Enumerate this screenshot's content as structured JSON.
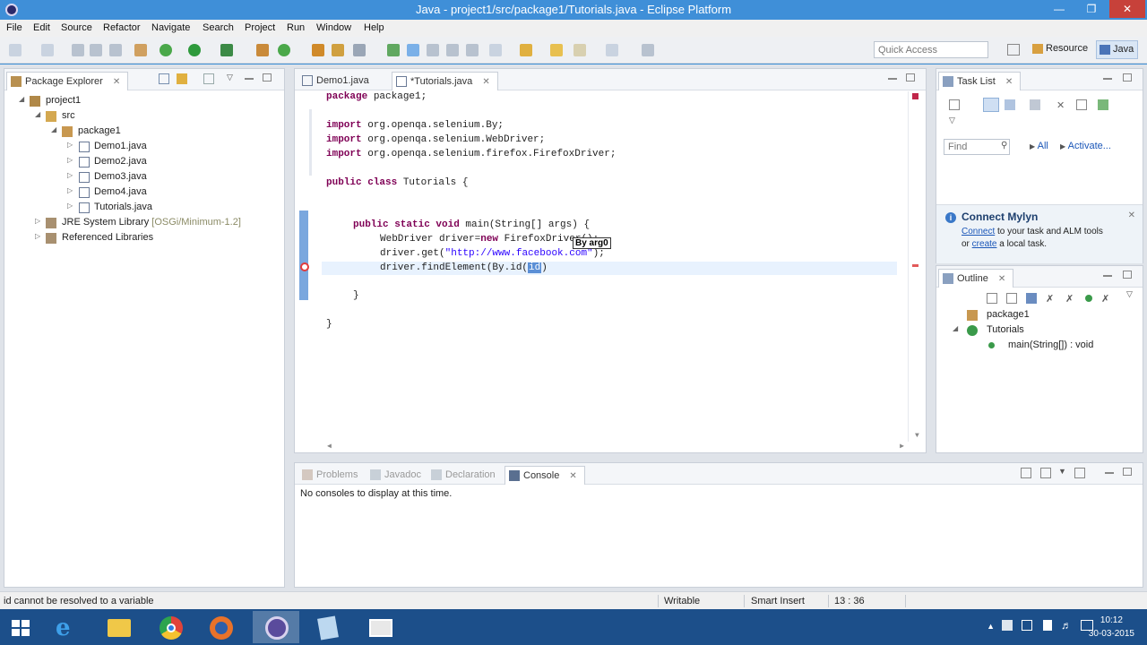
{
  "window": {
    "title": "Java - project1/src/package1/Tutorials.java - Eclipse Platform"
  },
  "menu": [
    "File",
    "Edit",
    "Source",
    "Refactor",
    "Navigate",
    "Search",
    "Project",
    "Run",
    "Window",
    "Help"
  ],
  "toolbar": {
    "quick_access_placeholder": "Quick Access",
    "perspectives": {
      "resource": "Resource",
      "java": "Java"
    }
  },
  "package_explorer": {
    "tab_label": "Package Explorer",
    "tree": [
      {
        "label": "project1",
        "icon": "project-icon"
      },
      {
        "label": "src",
        "icon": "source-folder-icon"
      },
      {
        "label": "package1",
        "icon": "package-icon"
      },
      {
        "label": "Demo1.java",
        "icon": "java-file-icon"
      },
      {
        "label": "Demo2.java",
        "icon": "java-file-icon"
      },
      {
        "label": "Demo3.java",
        "icon": "java-file-icon"
      },
      {
        "label": "Demo4.java",
        "icon": "java-file-icon"
      },
      {
        "label": "Tutorials.java",
        "icon": "java-file-icon"
      },
      {
        "label": "JRE System Library",
        "decoration": "[OSGi/Minimum-1.2]",
        "icon": "library-icon"
      },
      {
        "label": "Referenced Libraries",
        "icon": "library-icon"
      }
    ]
  },
  "editor": {
    "tabs": [
      {
        "label": "Demo1.java",
        "active": false
      },
      {
        "label": "*Tutorials.java",
        "active": true
      }
    ],
    "code": {
      "l1_kw": "package",
      "l1_rest": " package1;",
      "l2_kw": "import",
      "l2_rest": " org.openqa.selenium.By;",
      "l3_kw": "import",
      "l3_rest": " org.openqa.selenium.WebDriver;",
      "l4_kw": "import",
      "l4_rest": " org.openqa.selenium.firefox.FirefoxDriver;",
      "l5_kw": "public class",
      "l5_rest": " Tutorials {",
      "l6_kw": "public static void",
      "l6_rest": " main(String[] args) {",
      "l7_a": "WebDriver driver=",
      "l7_kw": "new",
      "l7_b": " FirefoxDriver();",
      "l8_a": "driver.get(",
      "l8_str": "\"http://www.facebook.com\"",
      "l8_b": ");",
      "l9_a": "driver.findElement(By.",
      "l9_b": "id(",
      "l9_sel": "id",
      "l9_c": ")",
      "l10": "}",
      "l11": "}"
    },
    "tooltip": "By arg0"
  },
  "task_list": {
    "tab_label": "Task List",
    "find_placeholder": "Find",
    "all_link": "All",
    "activate_link": "Activate...",
    "mylyn_title": "Connect Mylyn",
    "mylyn_connect": "Connect",
    "mylyn_text1": " to your task and ALM tools",
    "mylyn_text2_pre": "or ",
    "mylyn_create": "create",
    "mylyn_text2_post": " a local task."
  },
  "outline": {
    "tab_label": "Outline",
    "items": [
      {
        "label": "package1"
      },
      {
        "label": "Tutorials"
      },
      {
        "label": "main(String[]) : void"
      }
    ]
  },
  "bottom_panel": {
    "tabs": [
      "Problems",
      "Javadoc",
      "Declaration",
      "Console"
    ],
    "active_tab": "Console",
    "message": "No consoles to display at this time."
  },
  "status": {
    "message": "id cannot be resolved to a variable",
    "writable": "Writable",
    "insert_mode": "Smart Insert",
    "position": "13 : 36"
  },
  "taskbar": {
    "time": "10:12",
    "date": "30-03-2015"
  },
  "colors": {
    "keyword": "#7f0055",
    "string": "#2a00ff",
    "error": "#e23c3c",
    "titlebar": "#3f8fd8"
  }
}
